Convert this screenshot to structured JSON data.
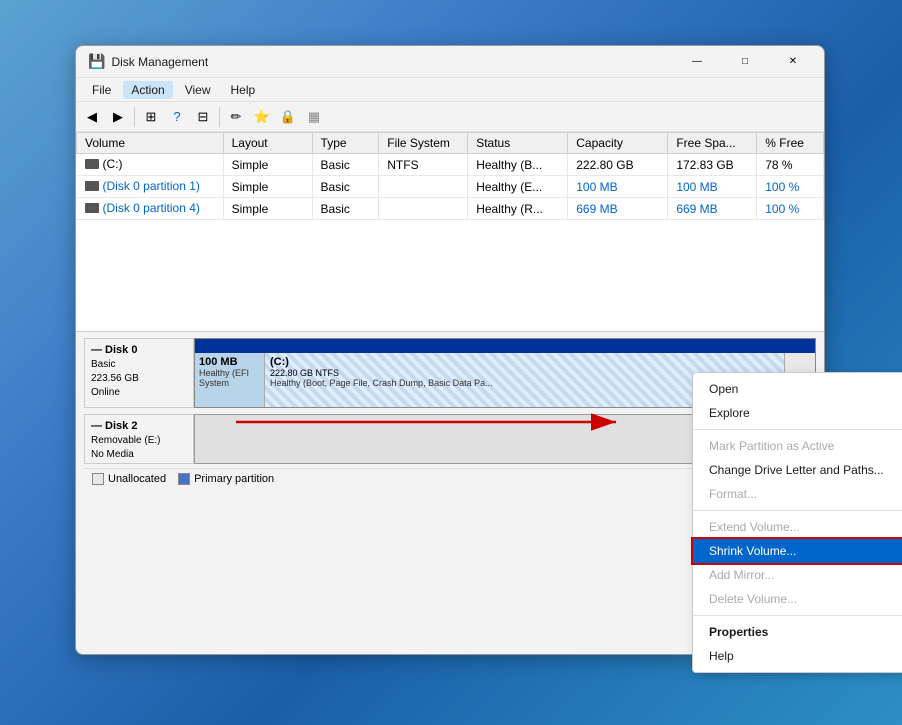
{
  "window": {
    "title": "Disk Management",
    "icon": "💾"
  },
  "titlebar_controls": {
    "minimize": "—",
    "maximize": "□",
    "close": "✕"
  },
  "menubar": {
    "items": [
      "File",
      "Action",
      "View",
      "Help"
    ]
  },
  "toolbar": {
    "buttons": [
      "◀",
      "▶",
      "⊞",
      "?",
      "⊟",
      "🖊",
      "⭐",
      "🔒"
    ]
  },
  "table": {
    "headers": [
      "Volume",
      "Layout",
      "Type",
      "File System",
      "Status",
      "Capacity",
      "Free Spa...",
      "% Free"
    ],
    "rows": [
      {
        "volume": "(C:)",
        "layout": "Simple",
        "type": "Basic",
        "fs": "NTFS",
        "status": "Healthy (B...",
        "capacity": "222.80 GB",
        "free": "172.83 GB",
        "pct": "78 %"
      },
      {
        "volume": "(Disk 0 partition 1)",
        "layout": "Simple",
        "type": "Basic",
        "fs": "",
        "status": "Healthy (E...",
        "capacity": "100 MB",
        "free": "100 MB",
        "pct": "100 %",
        "highlight": true
      },
      {
        "volume": "(Disk 0 partition 4)",
        "layout": "Simple",
        "type": "Basic",
        "fs": "",
        "status": "Healthy (R...",
        "capacity": "669 MB",
        "free": "669 MB",
        "pct": "100 %",
        "highlight": true
      }
    ]
  },
  "disk0": {
    "name": "Disk 0",
    "type": "Basic",
    "size": "223.56 GB",
    "status": "Online",
    "partitions": [
      {
        "label": "100 MB",
        "sublabel": "Healthy (EFI System",
        "type": "efi"
      },
      {
        "label": "(C:)",
        "sublabel": "222.80 GB NTFS\nHealthy (Boot, Page File, Crash Dump, Basic Data Pa...",
        "type": "main"
      },
      {
        "label": "",
        "sublabel": "",
        "type": "unalloc"
      }
    ]
  },
  "disk2": {
    "name": "Disk 2",
    "type": "Removable (E:)",
    "status": "No Media"
  },
  "legend": {
    "items": [
      {
        "label": "Unallocated",
        "type": "unalloc"
      },
      {
        "label": "Primary partition",
        "type": "primary"
      }
    ]
  },
  "context_menu": {
    "items": [
      {
        "label": "Open",
        "type": "normal"
      },
      {
        "label": "Explore",
        "type": "normal"
      },
      {
        "type": "separator"
      },
      {
        "label": "Mark Partition as Active",
        "type": "disabled"
      },
      {
        "label": "Change Drive Letter and Paths...",
        "type": "normal"
      },
      {
        "label": "Format...",
        "type": "disabled"
      },
      {
        "type": "separator"
      },
      {
        "label": "Extend Volume...",
        "type": "disabled"
      },
      {
        "label": "Shrink Volume...",
        "type": "highlighted"
      },
      {
        "label": "Add Mirror...",
        "type": "disabled"
      },
      {
        "label": "Delete Volume...",
        "type": "disabled"
      },
      {
        "type": "separator"
      },
      {
        "label": "Properties",
        "type": "bold"
      },
      {
        "label": "Help",
        "type": "normal"
      }
    ]
  }
}
